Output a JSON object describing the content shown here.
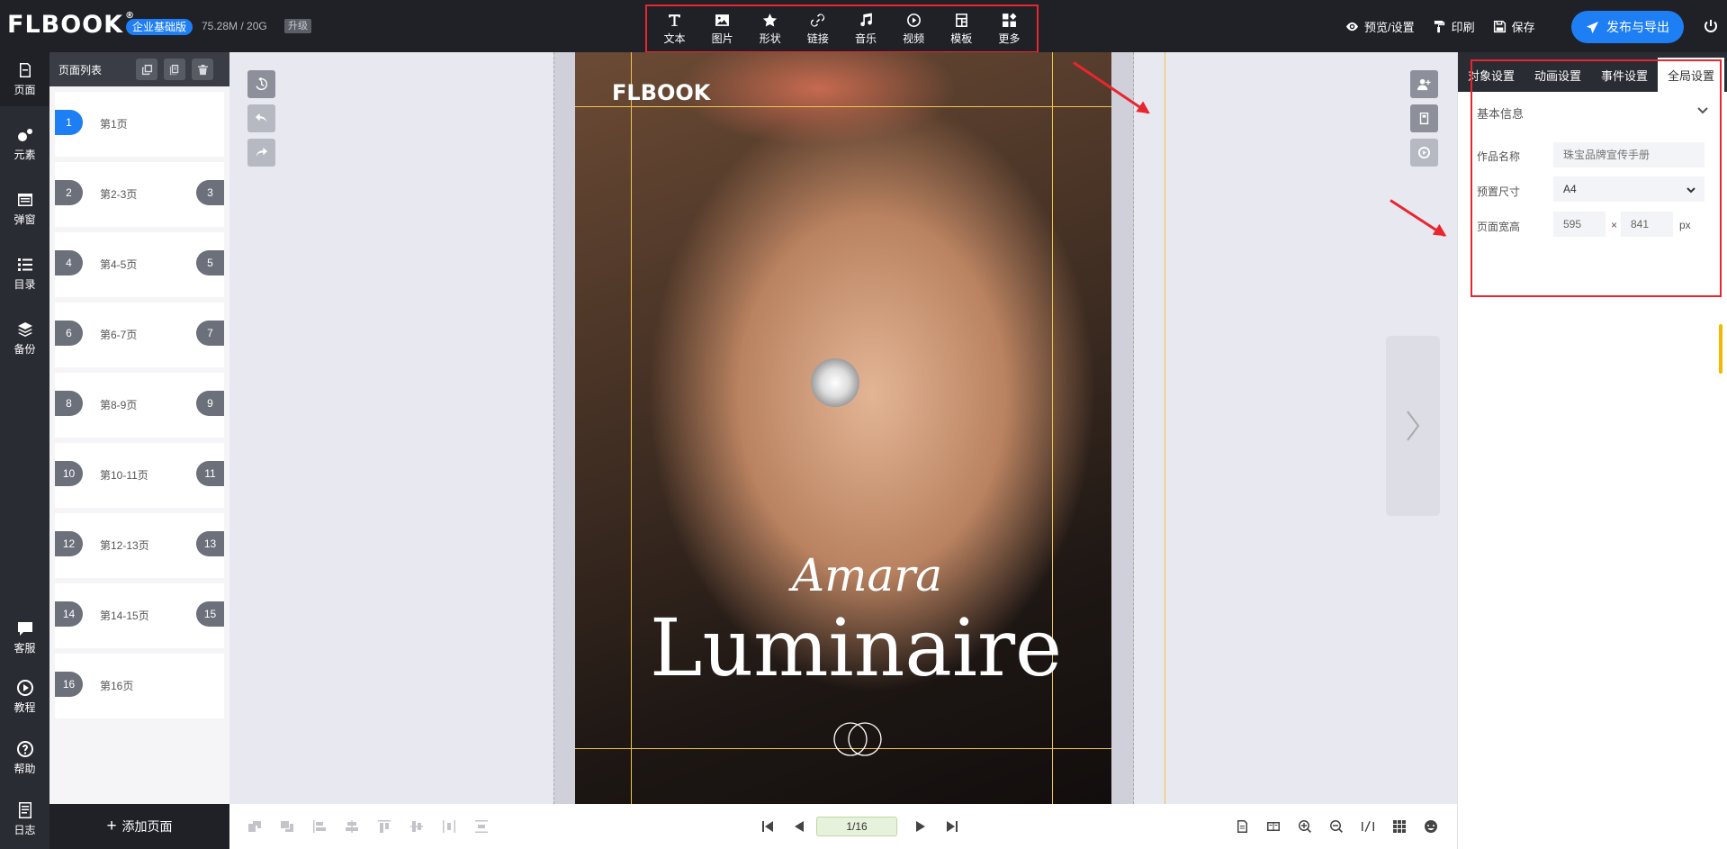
{
  "app": {
    "logo": "FLBOOK",
    "edition": "企业基础版",
    "storage": "75.28M / 20G",
    "upgrade": "升级"
  },
  "toolbar": {
    "items": [
      {
        "label": "文本",
        "icon": "text-icon"
      },
      {
        "label": "图片",
        "icon": "image-icon"
      },
      {
        "label": "形状",
        "icon": "star-icon"
      },
      {
        "label": "链接",
        "icon": "link-icon"
      },
      {
        "label": "音乐",
        "icon": "music-icon"
      },
      {
        "label": "视频",
        "icon": "video-icon"
      },
      {
        "label": "模板",
        "icon": "template-icon"
      },
      {
        "label": "更多",
        "icon": "more-icon"
      }
    ]
  },
  "topright": {
    "preview": "预览/设置",
    "print": "印刷",
    "save": "保存",
    "publish": "发布与导出"
  },
  "leftnav": {
    "items": [
      {
        "label": "页面",
        "icon": "page-icon"
      },
      {
        "label": "元素",
        "icon": "elements-icon"
      },
      {
        "label": "弹窗",
        "icon": "popup-icon"
      },
      {
        "label": "目录",
        "icon": "list-icon"
      },
      {
        "label": "备份",
        "icon": "layers-icon"
      },
      {
        "label": "客服",
        "icon": "chat-icon"
      },
      {
        "label": "教程",
        "icon": "play-icon"
      },
      {
        "label": "帮助",
        "icon": "help-icon"
      },
      {
        "label": "日志",
        "icon": "log-icon"
      }
    ]
  },
  "pagelist": {
    "title": "页面列表",
    "pages": [
      {
        "label": "第1页",
        "left": "1",
        "right": ""
      },
      {
        "label": "第2-3页",
        "left": "2",
        "right": "3"
      },
      {
        "label": "第4-5页",
        "left": "4",
        "right": "5"
      },
      {
        "label": "第6-7页",
        "left": "6",
        "right": "7"
      },
      {
        "label": "第8-9页",
        "left": "8",
        "right": "9"
      },
      {
        "label": "第10-11页",
        "left": "10",
        "right": "11"
      },
      {
        "label": "第12-13页",
        "left": "12",
        "right": "13"
      },
      {
        "label": "第14-15页",
        "left": "14",
        "right": "15"
      },
      {
        "label": "第16页",
        "left": "16",
        "right": ""
      }
    ],
    "add_label": "添加页面"
  },
  "canvas": {
    "page_logo": "FLBOOK",
    "script_text": "Amara",
    "headline": "Luminaire"
  },
  "pager": {
    "current": "1/16"
  },
  "rightpanel": {
    "tabs": [
      "对象设置",
      "动画设置",
      "事件设置",
      "全局设置"
    ],
    "section": "基本信息",
    "name_label": "作品名称",
    "name_placeholder": "珠宝品牌宣传手册",
    "size_label": "预置尺寸",
    "size_value": "A4",
    "dims_label": "页面宽高",
    "width": "595",
    "times": "×",
    "height": "841",
    "unit": "px"
  }
}
